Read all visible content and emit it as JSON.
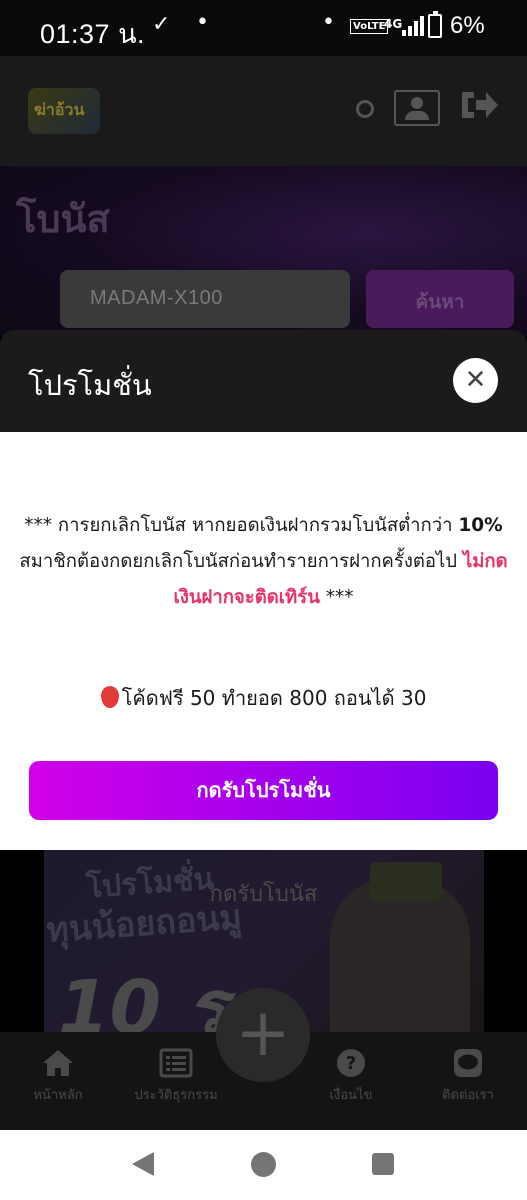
{
  "status_bar": {
    "time": "01:37 น.",
    "check_glyph": "✓",
    "dot": "•",
    "volte": "VoLTE",
    "network": "4G",
    "battery_percent": "6%"
  },
  "header": {
    "logo_text": "ฆ่าอ้วน",
    "icons": [
      "search-icon",
      "user-icon",
      "logout-icon"
    ]
  },
  "page": {
    "title": "โบนัส",
    "coupon_value": "MADAM-X100",
    "search_label": "ค้นหา"
  },
  "modal": {
    "title": "โปรโมชั่น",
    "close_glyph": "✕",
    "notice_part1": "*** การยกเลิกโบนัส หากยอดเงินฝากรวมโบนัสต่ำกว่า ",
    "notice_strong": "10%",
    "notice_part2": " สมาชิกต้องกดยกเลิกโบนัสก่อนทำรายการฝากครั้งต่อไป ",
    "notice_red": "ไม่กดเงินฝากจะติดเทิร์น",
    "notice_part3": " ***",
    "promo_text": "โค้ดฟรี 50 ทำยอด 800 ถอนได้ 30",
    "claim_label": "กดรับโปรโมชั่น"
  },
  "background": {
    "banner_line1": "โปรโมชั่น",
    "banner_line2": "ทุนน้อยถอนมู",
    "banner_big": "10 ร",
    "receive_label": "กดรับโบนัส"
  },
  "bottom_nav": {
    "items": [
      {
        "label": "หน้าหลัก",
        "icon": "home-icon"
      },
      {
        "label": "ประวัติธุรกรรม",
        "icon": "list-icon"
      },
      {
        "label": "เงื่อนไข",
        "icon": "question-icon"
      },
      {
        "label": "ติดต่อเรา",
        "icon": "line-chat-icon"
      }
    ],
    "fab_glyph": "+"
  },
  "colors": {
    "accent_start": "#d100e8",
    "accent_end": "#7a00f0",
    "warning": "#e8336a"
  }
}
